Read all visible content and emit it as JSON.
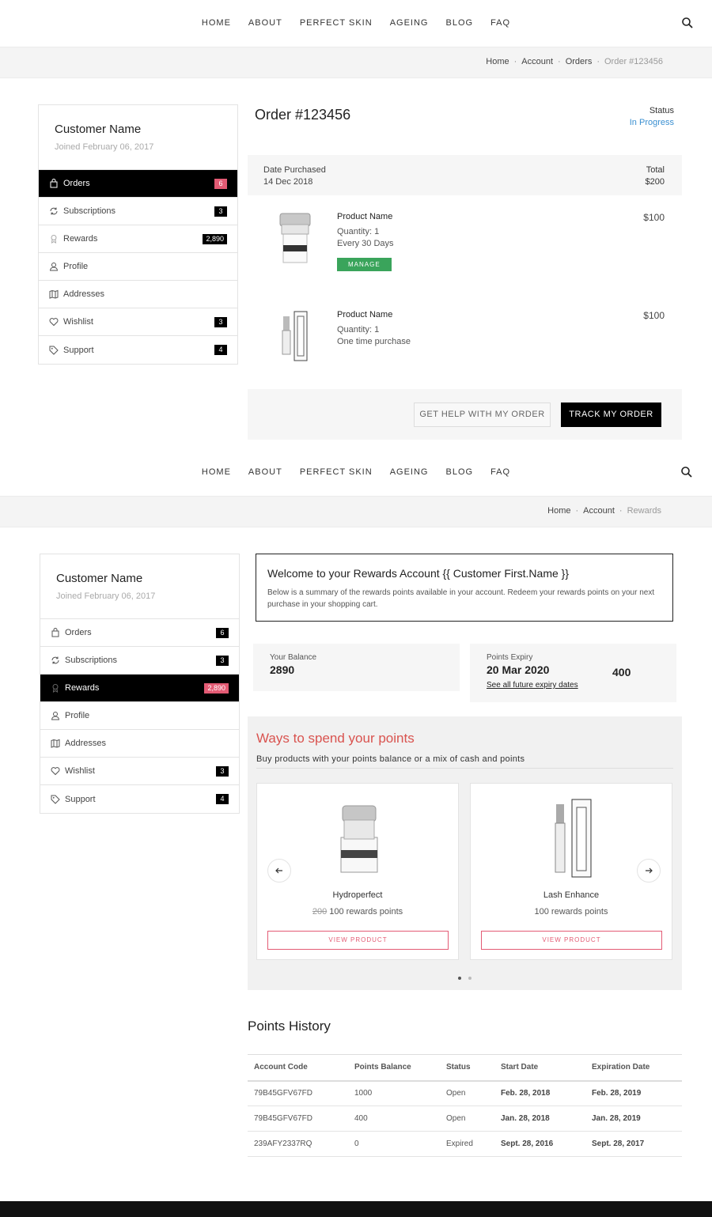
{
  "nav": {
    "items": [
      "HOME",
      "ABOUT",
      "PERFECT SKIN",
      "AGEING",
      "BLOG",
      "FAQ"
    ],
    "search_icon": "search-icon"
  },
  "breadcrumb_order": {
    "home": "Home",
    "account": "Account",
    "orders": "Orders",
    "current": "Order #123456"
  },
  "breadcrumb_rewards": {
    "home": "Home",
    "account": "Account",
    "current": "Rewards"
  },
  "sidebar": {
    "name": "Customer Name",
    "joined": "Joined February 06, 2017",
    "items": [
      {
        "label": "Orders",
        "badge": "6",
        "icon": "bag-icon"
      },
      {
        "label": "Subscriptions",
        "badge": "3",
        "icon": "refresh-icon"
      },
      {
        "label": "Rewards",
        "badge": "2,890",
        "icon": "award-icon"
      },
      {
        "label": "Profile",
        "badge": "",
        "icon": "user-icon"
      },
      {
        "label": "Addresses",
        "badge": "",
        "icon": "map-icon"
      },
      {
        "label": "Wishlist",
        "badge": "3",
        "icon": "heart-icon"
      },
      {
        "label": "Support",
        "badge": "4",
        "icon": "tag-icon"
      }
    ],
    "accent": "#e35b74"
  },
  "order": {
    "title": "Order #123456",
    "status_label": "Status",
    "status_value": "In Progress",
    "date_label": "Date Purchased",
    "date_value": "14 Dec 2018",
    "total_label": "Total",
    "total_value": "$200",
    "items": [
      {
        "name": "Product Name",
        "quantity": "Quantity: 1",
        "frequency": "Every 30 Days",
        "price": "$100",
        "manage": "MANAGE"
      },
      {
        "name": "Product Name",
        "quantity": "Quantity: 1",
        "frequency": "One time purchase",
        "price": "$100"
      }
    ],
    "help_button": "GET HELP WITH MY ORDER",
    "track_button": "TRACK MY ORDER"
  },
  "rewards": {
    "welcome_title": "Welcome to your Rewards Account {{ Customer First.Name }}",
    "welcome_text": "Below is a summary of the rewards points available in your account. Redeem your rewards points on your next purchase in your shopping cart.",
    "balance_label": "Your Balance",
    "balance_value": "2890",
    "expiry_label": "Points Expiry",
    "expiry_date": "20 Mar 2020",
    "expiry_points": "400",
    "expiry_link": "See all future expiry dates",
    "spend_title": "Ways to spend your points",
    "spend_sub": "Buy products with your points balance or a mix of cash and points",
    "products": [
      {
        "name": "Hydroperfect",
        "old_points": "200",
        "points": "100 rewards points",
        "button": "VIEW PRODUCT"
      },
      {
        "name": "Lash Enhance",
        "old_points": "",
        "points": "100 rewards points",
        "button": "VIEW PRODUCT"
      }
    ]
  },
  "history": {
    "title": "Points History",
    "columns": [
      "Account Code",
      "Points Balance",
      "Status",
      "Start Date",
      "Expiration Date"
    ],
    "rows": [
      {
        "code": "79B45GFV67FD",
        "balance": "1000",
        "status": "Open",
        "start": "Feb. 28, 2018",
        "end": "Feb. 28, 2019"
      },
      {
        "code": "79B45GFV67FD",
        "balance": "400",
        "status": "Open",
        "start": "Jan. 28, 2018",
        "end": "Jan. 28, 2019"
      },
      {
        "code": "239AFY2337RQ",
        "balance": "0",
        "status": "Expired",
        "start": "Sept. 28, 2016",
        "end": "Sept. 28, 2017"
      }
    ]
  }
}
